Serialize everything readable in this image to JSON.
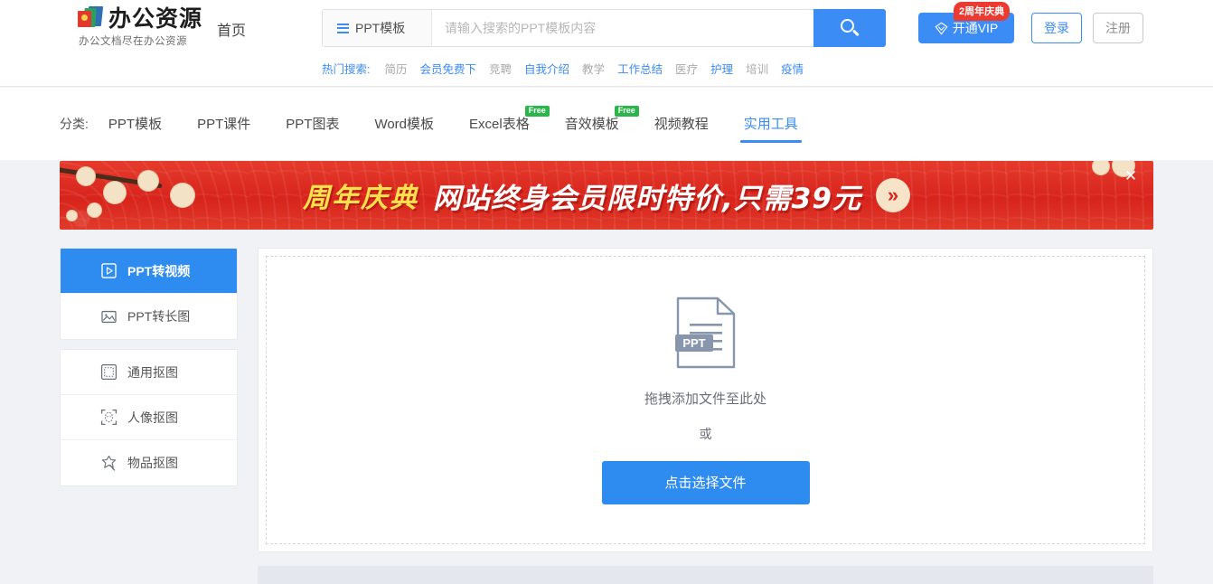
{
  "site": {
    "logo_text": "办公资源",
    "logo_sub": "办公文档尽在办公资源",
    "logo_icon": "books-logo-icon"
  },
  "header": {
    "home_label": "首页",
    "search": {
      "category_label": "PPT模板",
      "placeholder": "请输入搜索的PPT模板内容",
      "value": "",
      "menu_icon": "hamburger-icon",
      "search_icon": "search-icon"
    },
    "hot": {
      "label": "热门搜索:",
      "items": [
        {
          "label": "简历",
          "style": "gray"
        },
        {
          "label": "会员免费下",
          "style": "blue"
        },
        {
          "label": "竞聘",
          "style": "gray"
        },
        {
          "label": "自我介绍",
          "style": "blue"
        },
        {
          "label": "教学",
          "style": "gray"
        },
        {
          "label": "工作总结",
          "style": "blue"
        },
        {
          "label": "医疗",
          "style": "gray"
        },
        {
          "label": "护理",
          "style": "blue"
        },
        {
          "label": "培训",
          "style": "gray"
        },
        {
          "label": "疫情",
          "style": "blue"
        }
      ]
    },
    "vip": {
      "label": "开通VIP",
      "badge": "2周年庆典",
      "icon": "diamond-icon"
    },
    "login_label": "登录",
    "register_label": "注册"
  },
  "categories": {
    "label": "分类:",
    "items": [
      {
        "label": "PPT模板",
        "active": false,
        "badge": ""
      },
      {
        "label": "PPT课件",
        "active": false,
        "badge": ""
      },
      {
        "label": "PPT图表",
        "active": false,
        "badge": ""
      },
      {
        "label": "Word模板",
        "active": false,
        "badge": ""
      },
      {
        "label": "Excel表格",
        "active": false,
        "badge": "Free"
      },
      {
        "label": "音效模板",
        "active": false,
        "badge": "Free"
      },
      {
        "label": "视频教程",
        "active": false,
        "badge": ""
      },
      {
        "label": "实用工具",
        "active": true,
        "badge": ""
      }
    ]
  },
  "banner": {
    "highlight": "周年庆典",
    "text": "网站终身会员限时特价,只需39元",
    "arrow": "»",
    "close_icon": "close-icon",
    "bg_color": "#d8241c",
    "highlight_color": "#ffe14d"
  },
  "sidebar": {
    "groups": [
      {
        "items": [
          {
            "label": "PPT转视频",
            "icon": "play-box-icon",
            "active": true
          },
          {
            "label": "PPT转长图",
            "icon": "image-icon",
            "active": false
          }
        ]
      },
      {
        "items": [
          {
            "label": "通用抠图",
            "icon": "dashed-square-icon",
            "active": false
          },
          {
            "label": "人像抠图",
            "icon": "portrait-cutout-icon",
            "active": false
          },
          {
            "label": "物品抠图",
            "icon": "magic-wand-icon",
            "active": false
          }
        ]
      }
    ]
  },
  "main": {
    "dropzone": {
      "file_icon_label": "PPT",
      "file_icon": "ppt-file-icon",
      "drag_text": "拖拽添加文件至此处",
      "or_text": "或",
      "button_label": "点击选择文件"
    }
  },
  "colors": {
    "accent_blue": "#2e8cf0",
    "link_blue": "#3b8cf5",
    "banner_red": "#d8241c",
    "free_green": "#2ab64a",
    "badge_red": "#ec3a31"
  }
}
